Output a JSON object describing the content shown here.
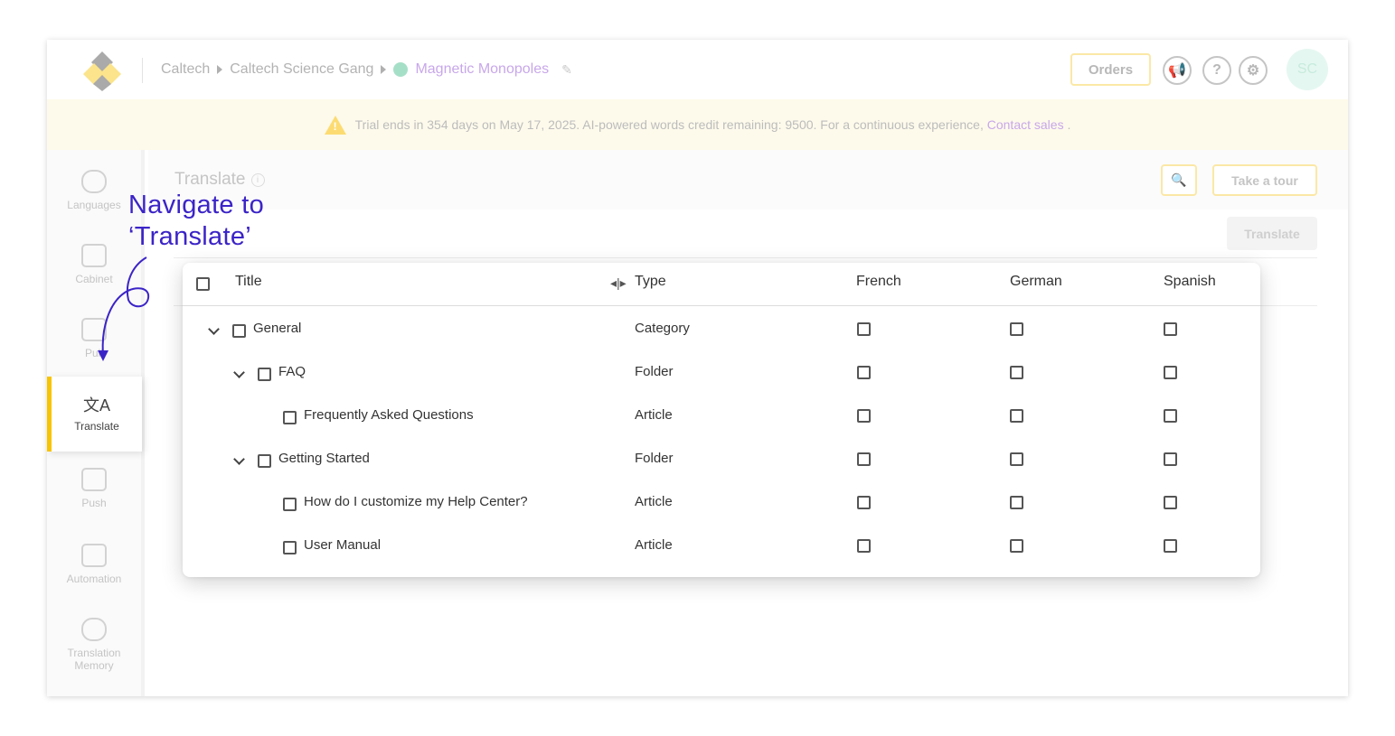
{
  "breadcrumb": [
    "Caltech",
    "Caltech Science Gang",
    "Magnetic Monopoles"
  ],
  "header": {
    "orders_label": "Orders",
    "avatar_initials": "SC"
  },
  "trial_banner": {
    "text": "Trial ends in 354 days on May 17, 2025. AI-powered words credit remaining: 9500. For a continuous experience,",
    "link": "Contact sales",
    "suffix": "."
  },
  "sidebar": {
    "items": [
      {
        "label": "Languages",
        "icon": "languages-icon"
      },
      {
        "label": "Cabinet",
        "icon": "cabinet-icon"
      },
      {
        "label": "Pull",
        "icon": "pull-icon"
      },
      {
        "label": "Translate",
        "icon": "translate-icon",
        "active": true
      },
      {
        "label": "Push",
        "icon": "push-icon"
      },
      {
        "label": "Automation",
        "icon": "automation-icon"
      },
      {
        "label": "Translation Memory",
        "icon": "translation-memory-icon"
      }
    ]
  },
  "page": {
    "title": "Translate",
    "tour_label": "Take a tour",
    "translate_label": "Translate"
  },
  "annotation": {
    "line1": "Navigate to",
    "line2": "‘Translate’"
  },
  "table": {
    "columns": [
      "Title",
      "Type",
      "French",
      "German",
      "Spanish"
    ],
    "rows": [
      {
        "title": "General",
        "type": "Category",
        "level": 0,
        "expandable": true
      },
      {
        "title": "FAQ",
        "type": "Folder",
        "level": 1,
        "expandable": true
      },
      {
        "title": "Frequently Asked Questions",
        "type": "Article",
        "level": 2,
        "expandable": false
      },
      {
        "title": "Getting Started",
        "type": "Folder",
        "level": 1,
        "expandable": true
      },
      {
        "title": "How do I customize my Help Center?",
        "type": "Article",
        "level": 2,
        "expandable": false
      },
      {
        "title": "User Manual",
        "type": "Article",
        "level": 2,
        "expandable": false
      }
    ]
  },
  "colors": {
    "accent": "#f7c400",
    "annotation": "#3b24c7",
    "link": "#c8a7ea"
  }
}
